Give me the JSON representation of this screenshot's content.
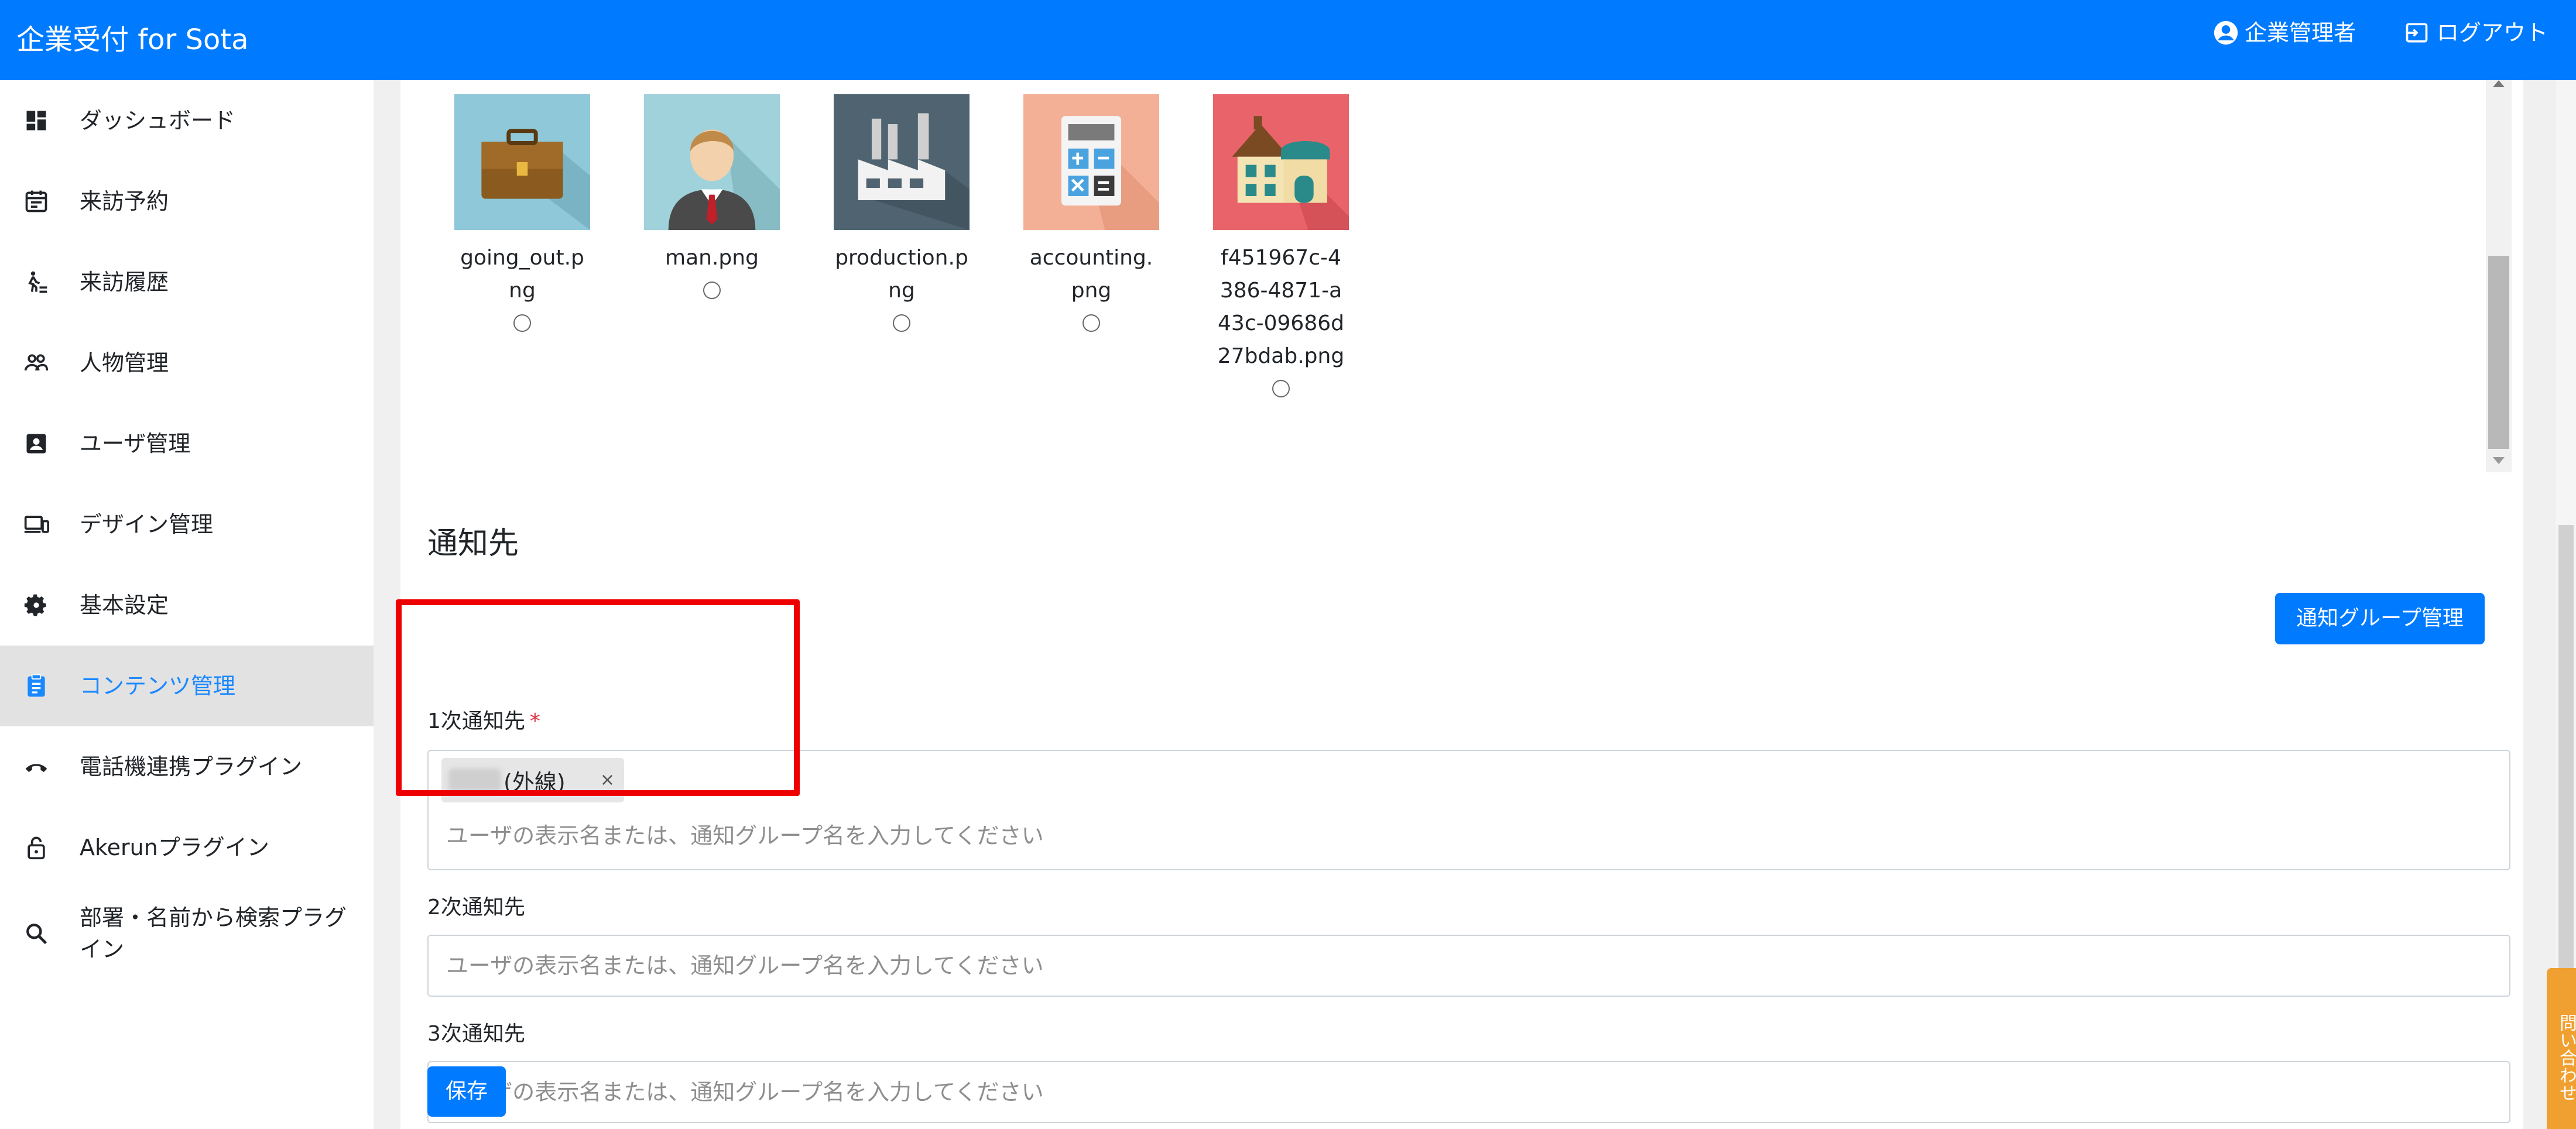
{
  "header": {
    "title": "企業受付 for Sota",
    "user_label": "企業管理者",
    "logout_label": "ログアウト"
  },
  "sidebar": {
    "items": [
      {
        "label": "ダッシュボード",
        "icon": "dashboard-icon"
      },
      {
        "label": "来訪予約",
        "icon": "calendar-icon"
      },
      {
        "label": "来訪履歴",
        "icon": "walking-person-icon"
      },
      {
        "label": "人物管理",
        "icon": "people-icon"
      },
      {
        "label": "ユーザ管理",
        "icon": "user-badge-icon"
      },
      {
        "label": "デザイン管理",
        "icon": "devices-icon"
      },
      {
        "label": "基本設定",
        "icon": "gear-icon"
      },
      {
        "label": "コンテンツ管理",
        "icon": "clipboard-icon",
        "active": true
      },
      {
        "label": "電話機連携プラグイン",
        "icon": "phone-icon"
      },
      {
        "label": "Akerunプラグイン",
        "icon": "lock-icon"
      },
      {
        "label": "部署・名前から検索プラグイン",
        "icon": "search-icon"
      }
    ]
  },
  "gallery": {
    "images": [
      {
        "name": "going_out.png",
        "icon": "briefcase-icon"
      },
      {
        "name": "man.png",
        "icon": "man-icon"
      },
      {
        "name": "production.png",
        "icon": "factory-icon"
      },
      {
        "name": "accounting.png",
        "icon": "calculator-icon"
      },
      {
        "name": "f451967c-4386-4871-a43c-09686d27bdab.png",
        "icon": "house-icon"
      }
    ]
  },
  "notification": {
    "title": "通知先",
    "group_button": "通知グループ管理",
    "primary": {
      "label": "1次通知先",
      "required_mark": "*",
      "chip_text": "(外線)",
      "chip_remove": "×",
      "placeholder": "ユーザの表示名または、通知グループ名を入力してください"
    },
    "secondary": {
      "label": "2次通知先",
      "placeholder": "ユーザの表示名または、通知グループ名を入力してください"
    },
    "tertiary": {
      "label": "3次通知先",
      "placeholder": "ユーザの表示名または、通知グループ名を入力してください"
    },
    "save_button": "保存"
  },
  "feedback_tab": {
    "text": "問い合わせ"
  },
  "colors": {
    "header": "#007bff",
    "active_text": "#1a88ff",
    "highlight": "#ee0000"
  }
}
